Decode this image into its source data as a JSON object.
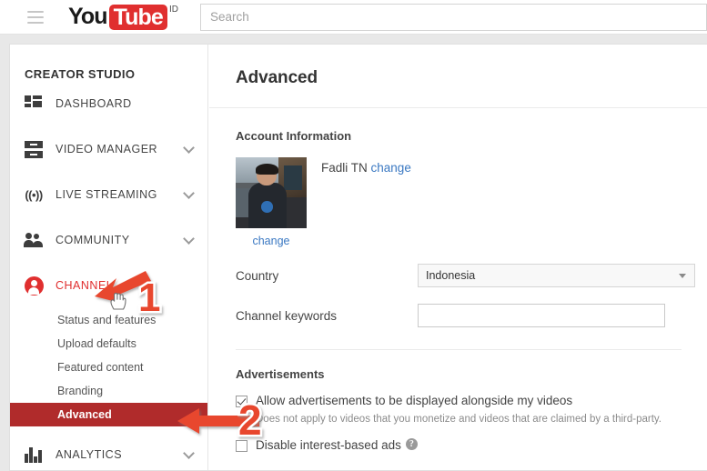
{
  "topbar": {
    "menu_icon": "hamburger-icon",
    "logo": {
      "part1": "You",
      "part2": "Tube",
      "locale": "ID"
    },
    "search": {
      "placeholder": "Search",
      "value": ""
    }
  },
  "sidebar": {
    "title": "CREATOR STUDIO",
    "items": [
      {
        "label": "DASHBOARD",
        "icon": "dashboard-icon",
        "expandable": false,
        "active": false
      },
      {
        "label": "VIDEO MANAGER",
        "icon": "video-manager-icon",
        "expandable": true,
        "active": false
      },
      {
        "label": "LIVE STREAMING",
        "icon": "live-streaming-icon",
        "expandable": true,
        "active": false
      },
      {
        "label": "COMMUNITY",
        "icon": "community-icon",
        "expandable": true,
        "active": false
      },
      {
        "label": "CHANNEL",
        "icon": "channel-icon",
        "expandable": false,
        "active": true
      },
      {
        "label": "ANALYTICS",
        "icon": "analytics-icon",
        "expandable": true,
        "active": false
      }
    ],
    "channel_submenu": [
      {
        "label": "Status and features",
        "selected": false
      },
      {
        "label": "Upload defaults",
        "selected": false
      },
      {
        "label": "Featured content",
        "selected": false
      },
      {
        "label": "Branding",
        "selected": false
      },
      {
        "label": "Advanced",
        "selected": true
      }
    ]
  },
  "main": {
    "page_title": "Advanced",
    "account_section": {
      "heading": "Account Information",
      "avatar_change_label": "change",
      "account_name": "Fadli TN",
      "name_change_label": "change",
      "country": {
        "label": "Country",
        "value": "Indonesia"
      },
      "keywords": {
        "label": "Channel keywords",
        "value": "",
        "placeholder": ""
      }
    },
    "ads_section": {
      "heading": "Advertisements",
      "allow_ads": {
        "label": "Allow advertisements to be displayed alongside my videos",
        "sublabel": "Does not apply to videos that you monetize and videos that are claimed by a third-party.",
        "checked": true
      },
      "disable_interest_ads": {
        "label": "Disable interest-based ads",
        "checked": false,
        "help_icon": "help-question-icon"
      }
    }
  },
  "annotations": {
    "marker_one": "1",
    "marker_two": "2",
    "accent_color": "#e8472e",
    "cursor_icon": "pointer-hand-cursor"
  }
}
